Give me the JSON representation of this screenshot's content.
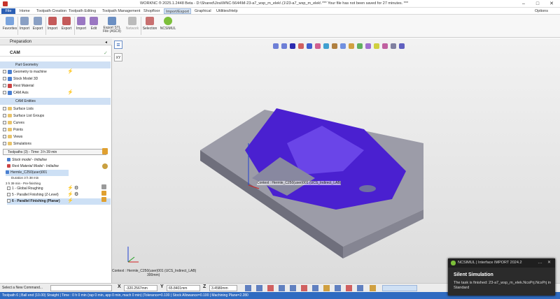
{
  "window": {
    "title": "WORKNC ® 2025.1.2448 Beta - D:\\Shared\\Jira\\WNC-5644\\M-23-a7_wsp_m_elek\\ (1\\23-a7_wsp_m_elek\\ *** Your file has not been saved for 27 minutes. ***"
  },
  "menu": {
    "file": "File",
    "items": [
      "Home",
      "Toolpath Creation",
      "Toolpath Editing",
      "Toolpath Management",
      "Shopfloor",
      "Import/Export",
      "Graphical",
      "Utilities/Help"
    ],
    "options": "Options"
  },
  "ribbon": {
    "buttons": [
      "Favorites",
      "Import",
      "Export",
      "Import",
      "Export",
      "Import",
      "Edit",
      "Export STL File (ASCII)",
      "Network",
      "Selection",
      "NCSIMUL"
    ]
  },
  "panel": {
    "title": "Preparation",
    "cam_header": "CAM",
    "part_geometry": "Part Geometry",
    "geom_items": [
      "Geometry to machine",
      "Stock Model 3D",
      "Rest Material",
      "CAM Axis"
    ],
    "cam_entities": "CAM Entities",
    "cam_items": [
      "Surface Lists",
      "Surface List Groups",
      "Curves",
      "Points",
      "Views",
      "Simulations"
    ],
    "toolpaths": "Toolpaths (3) - Time: 3 h 39 min",
    "tp_items": [
      "Stock model - Initialise",
      "Rest Material Model - Initialise",
      "Hermle_C250(user)001",
      "Duration 3 h 38 min",
      "3 h 39 min - Pre-finishing",
      "1 - Global Roughing",
      "5 - Parallel Finishing (Z-Level)",
      "6 - Parallel Finishing (Planar)"
    ]
  },
  "viewport": {
    "context": "Context : Hermle_C250(user)001 (UCS_Indirect_LAB)",
    "context2": "300mm)",
    "label3d": "Context : Hermle_C250(user)001 (UCS_Indirect_LAB)"
  },
  "cmd": {
    "placeholder": "Select a New Command...",
    "x_label": "X",
    "x": "-320.2567mm",
    "y_label": "Y",
    "y": "65.8401mm",
    "z_label": "Z",
    "z": "3.4580mm"
  },
  "status": "Toolpath 6 | Ball end (10.00) Straight | Time : 0 h 0 min (rap 0 min, app 0 min, mach 0 min) |Tolerance=0.100 | Stock Allowance=0.100 | Machining Plane=2.280",
  "toast": {
    "header": "NCSIMUL | Interface IMPORT 2024.2",
    "title": "Silent Simulation",
    "body": "The task is finished: 23-a7_wsp_m_elek.NcsPrj.NcsPrj in Standard"
  },
  "colors": {
    "accent": "#2b5fb4",
    "part_blue": "#4a1fd0",
    "part_grey": "#8a8a9a"
  }
}
